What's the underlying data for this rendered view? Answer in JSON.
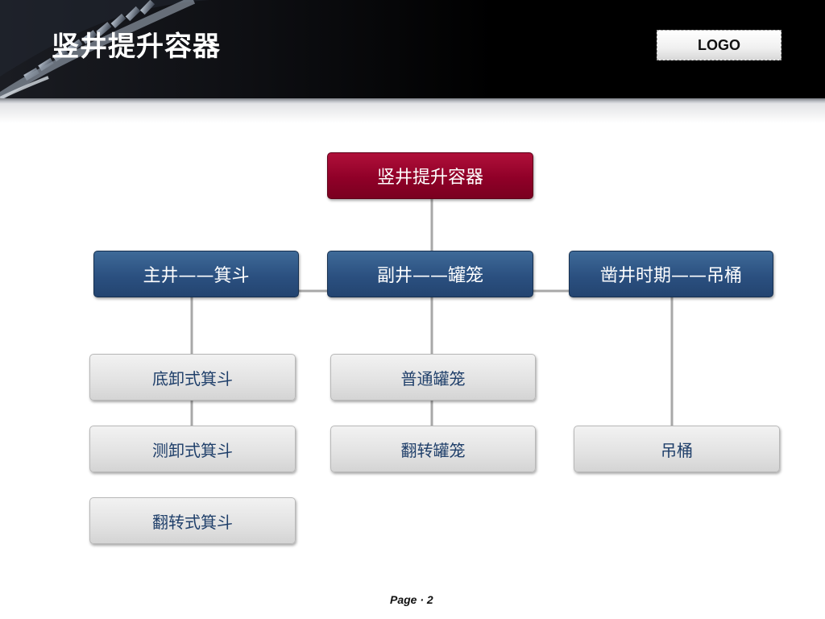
{
  "slide": {
    "title": "竖井提升容器",
    "logo": "LOGO",
    "footer_label": "Page",
    "footer_separator": "·",
    "page_number": "2"
  },
  "diagram": {
    "root": "竖井提升容器",
    "branches": [
      {
        "label": "主井——箕斗",
        "children": [
          "底卸式箕斗",
          "测卸式箕斗",
          "翻转式箕斗"
        ]
      },
      {
        "label": "副井——罐笼",
        "children": [
          "普通罐笼",
          "翻转罐笼"
        ]
      },
      {
        "label": "凿井时期——吊桶",
        "children": [
          "吊桶"
        ]
      }
    ]
  },
  "colors": {
    "root_fill": "#900028",
    "branch_fill": "#2b5080",
    "leaf_fill": "#e2e2e2",
    "leaf_text": "#1f3f6a",
    "connector": "#a8a8a8"
  }
}
